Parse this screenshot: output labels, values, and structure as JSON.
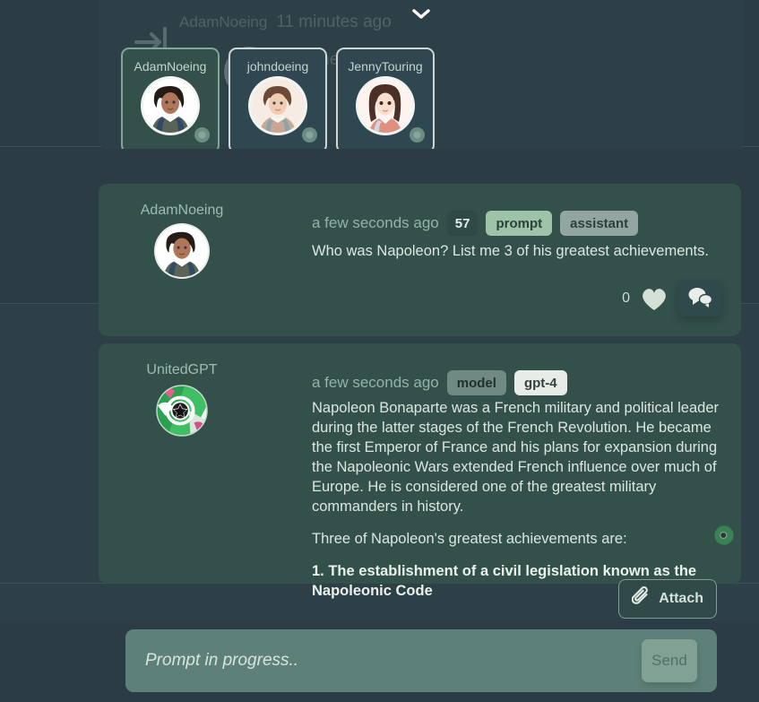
{
  "theme": {
    "page_bg": "#2b3c44",
    "panel_bg": "#2d4048",
    "card_bg": "#33504a",
    "accent_green": "#9ec4a8",
    "composer_bg": "#5d8178",
    "text_primary": "#dbe6df",
    "text_muted": "#93b3a7"
  },
  "top_panel": {
    "collapse_icon": "chevron-down-icon",
    "joined_notice": {
      "icon": "login-arrow-icon",
      "user": "AdamNoeing",
      "time": "11 minutes ago",
      "text": "has joined the room."
    },
    "members": [
      {
        "name": "AdamNoeing",
        "status": "online",
        "active": true
      },
      {
        "name": "johndoeing",
        "status": "online",
        "active": false
      },
      {
        "name": "JennyTouring",
        "status": "online",
        "active": false
      }
    ]
  },
  "messages": [
    {
      "author": "AdamNoeing",
      "avatar": "user-avatar",
      "time": "a few seconds ago",
      "chips": [
        {
          "label": "57",
          "style": "count"
        },
        {
          "label": "prompt",
          "style": "green"
        },
        {
          "label": "assistant",
          "style": "gray"
        }
      ],
      "text": "Who was Napoleon? List me 3 of his greatest achievements.",
      "like_count": "0",
      "heart_icon": "heart-icon",
      "reply_icon": "chat-bubbles-icon"
    },
    {
      "author": "UnitedGPT",
      "avatar": "bot-avatar",
      "time": "a few seconds ago",
      "chips": [
        {
          "label": "model",
          "style": "muted"
        },
        {
          "label": "gpt-4",
          "style": "light"
        }
      ],
      "paragraphs": [
        "Napoleon Bonaparte was a French military and political leader during the latter stages of the French Revolution. He became the first Emperor of France and his plans for expansion during the Napoleonic Wars extended French influence over much of Europe. He is considered one of the greatest military commanders in history.",
        "Three of Napoleon's greatest achievements are:"
      ],
      "list_item_1": "1. The establishment of a civil legislation known as the Napoleonic Code"
    }
  ],
  "composer": {
    "attach_label": "Attach",
    "attach_icon": "paperclip-icon",
    "placeholder": "Prompt in progress..",
    "value": "",
    "send_label": "Send"
  }
}
